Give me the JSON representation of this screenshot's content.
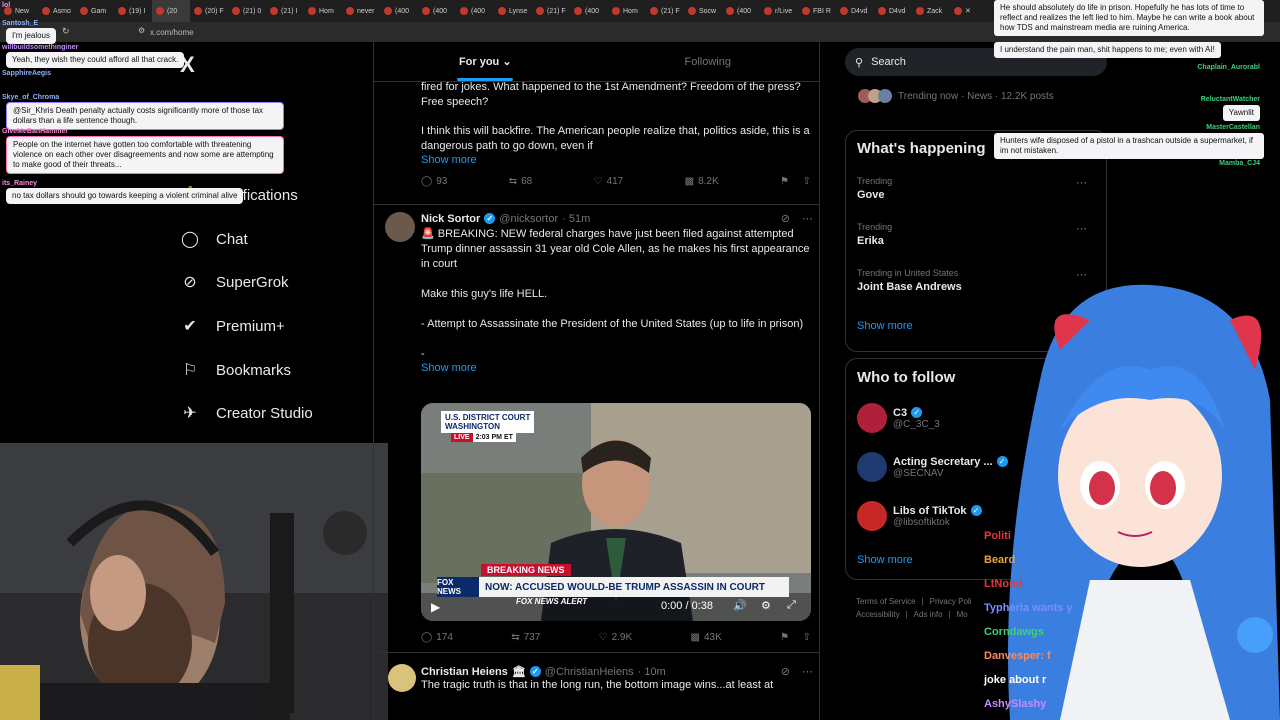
{
  "browser": {
    "tabs": [
      "New",
      "Asmo",
      "Gam",
      "(19) I",
      "(20",
      "(20) F",
      "(21) 0",
      "(21) I",
      "Hom",
      "never",
      "(400",
      "(400",
      "(400",
      "Lynse",
      "(21) F",
      "(400",
      "Hom",
      "(21) F",
      "Socw",
      "(400",
      "r/Live",
      "FBI R",
      "D4vd",
      "D4vd",
      "Zack",
      "✕"
    ],
    "url": "x.com/home"
  },
  "nav": {
    "logo": "X",
    "items": [
      {
        "label": "Notifications",
        "icon": "bell-icon"
      },
      {
        "label": "Chat",
        "icon": "chat-icon"
      },
      {
        "label": "SuperGrok",
        "icon": "grok-icon"
      },
      {
        "label": "Premium+",
        "icon": "premium-badge-icon"
      },
      {
        "label": "Bookmarks",
        "icon": "bookmark-icon"
      },
      {
        "label": "Creator Studio",
        "icon": "rocket-icon"
      }
    ]
  },
  "feed": {
    "tabs": [
      "For you",
      "Following"
    ],
    "post1": {
      "text_a": "fired for jokes. What happened to the 1st Amendment? Freedom of the press? Free speech?",
      "text_b": "I think this will backfire. The American people realize that, politics aside, this is a dangerous path to go down, even if",
      "show_more": "Show more",
      "replies": "93",
      "reposts": "68",
      "likes": "417",
      "views": "8.2K"
    },
    "post2": {
      "name": "Nick Sortor",
      "handle": "@nicksortor",
      "time": "· 51m",
      "text_1": "🚨 BREAKING: NEW federal charges have just been filed against attempted Trump dinner assassin 31 year old Cole Allen, as he makes his first appearance in court",
      "text_2": "Make this guy's life HELL.",
      "text_3": "- Attempt to Assassinate the President of the United States (up to life in prison)",
      "text_4": "-",
      "show_more": "Show more",
      "video": {
        "court_label_1": "U.S. DISTRICT COURT",
        "court_label_2": "WASHINGTON",
        "live": "LIVE",
        "time": "2:03 PM ET",
        "breaking": "BREAKING NEWS",
        "headline": "NOW: ACCUSED WOULD-BE TRUMP ASSASSIN IN COURT",
        "alert": "FOX NEWS ALERT",
        "network": "FOX NEWS",
        "timecode": "0:00 / 0:38"
      },
      "replies": "174",
      "reposts": "737",
      "likes": "2.9K",
      "views": "43K"
    },
    "post3": {
      "name": "Christian Heiens",
      "handle": "@ChristianHeiens",
      "time": "· 10m",
      "text": "The tragic truth is that in the long run, the bottom image wins...at least at"
    }
  },
  "sidebar": {
    "search_placeholder": "Search",
    "trending_now": "Trending now · News · 12.2K posts",
    "happening_title": "What's happening",
    "trends": [
      {
        "meta": "Trending",
        "name": "Gove"
      },
      {
        "meta": "Trending",
        "name": "Erika"
      },
      {
        "meta": "Trending in United States",
        "name": "Joint Base Andrews"
      }
    ],
    "show_more": "Show more",
    "follow_title": "Who to follow",
    "follow": [
      {
        "name": "C3",
        "handle": "@C_3C_3",
        "color": "#b0203a"
      },
      {
        "name": "Acting Secretary ...",
        "handle": "@SECNAV",
        "color": "#1e3a6e"
      },
      {
        "name": "Libs of TikTok",
        "handle": "@libsoftiktok",
        "color": "#c62828"
      }
    ],
    "follow_show_more": "Show more",
    "footer": [
      "Terms of Service",
      "|",
      "Privacy Poli",
      "Accessibility",
      "|",
      "Ads info",
      "|",
      "Mo"
    ]
  },
  "left_chat": [
    {
      "user": "lol",
      "msg": "",
      "color": "#ff8ad8"
    },
    {
      "user": "Santosh_E",
      "msg": "I'm jealous",
      "color": "#8fb0ff"
    },
    {
      "user": "willbuildsomethinginer",
      "msg": "Yeah, they wish they could afford all that crack.",
      "color": "#c48cff"
    },
    {
      "user": "SapphireAegis",
      "msg": "",
      "color": "#8fb0ff"
    },
    {
      "user": "Skye_of_Chroma",
      "msg": "@Sir_Khris Death penalty actually costs significantly more of those tax dollars than a life sentence though.",
      "color": "#8fb0ff"
    },
    {
      "user": "GiveMeBanHammer",
      "msg": "People on the internet have gotten too comfortable with threatening violence on each other over disagreements and now some are attempting to make good of their threats...",
      "color": "#ff8ad8"
    },
    {
      "user": "its_Rainey",
      "msg": "no tax dollars should go towards keeping a violent criminal alive",
      "color": "#ff8ad8"
    }
  ],
  "right_chat": [
    {
      "user": "",
      "msg": "He should absolutely do life in prison. Hopefully he has lots of time to reflect and realizes the left lied to him. Maybe he can write a book about how TDS and mainstream media are ruining America."
    },
    {
      "user": "",
      "msg": "I understand the pain man, shit happens to me; even with AI!"
    },
    {
      "user": "Chaplain_Aurorabl",
      "msg": ""
    },
    {
      "user": "ReluctantWatcher",
      "msg": "Yawnlit"
    },
    {
      "user": "MasterCastellan",
      "msg": "Hunters wife disposed of a pistol in a trashcan outside a supermarket, if im not mistaken."
    },
    {
      "user": "Mamba_CJ4",
      "msg": ""
    }
  ],
  "ticker": [
    {
      "text": "Politi",
      "color": "#e0393e"
    },
    {
      "text": "Beard",
      "color": "#e7a33e"
    },
    {
      "text": "LtNond",
      "color": "#e0393e"
    },
    {
      "text": "Typheria wants y",
      "color": "#7b8cff"
    },
    {
      "text": "Corndawgs",
      "color": "#3fd07a"
    },
    {
      "text": "Danvesper: f",
      "color": "#ff8a5c"
    },
    {
      "text": "joke about r",
      "color": "#ffffff"
    },
    {
      "text": "AshySlashy",
      "color": "#c48cff"
    }
  ]
}
